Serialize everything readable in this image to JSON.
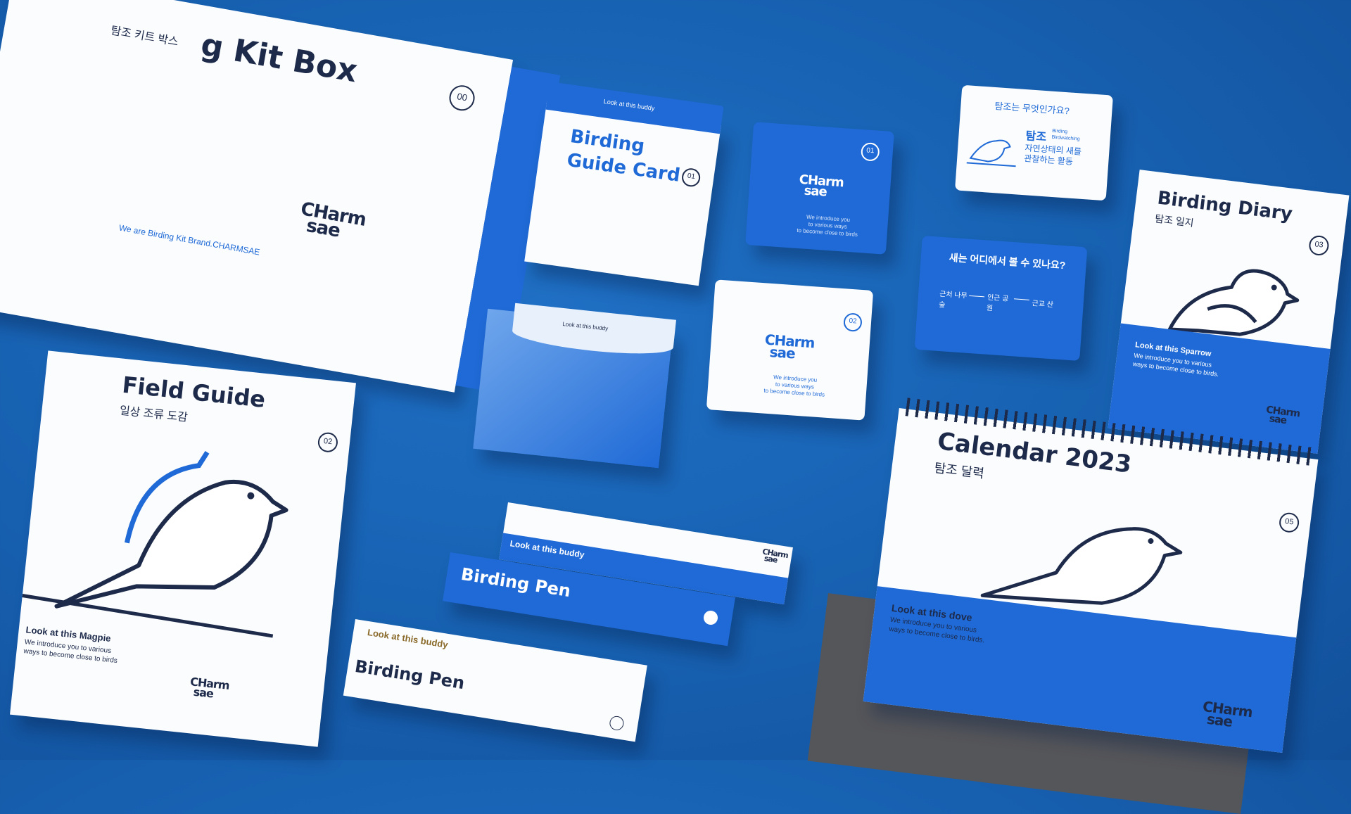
{
  "box": {
    "title": "g Kit Box",
    "subtitle": "탐조 키트 박스",
    "number": "00",
    "tagline": "We are Birding Kit Brand.CHARMSAE",
    "logo_line1": "CHarm",
    "logo_line2": "sae"
  },
  "guide_card": {
    "title_line1": "Birding",
    "title_line2": "Guide Card",
    "number": "01",
    "flap_text": "Look at this buddy"
  },
  "card_01": {
    "number": "01",
    "logo_line1": "CHarm",
    "logo_line2": "sae",
    "caption_line1": "We introduce you",
    "caption_line2": "to various ways",
    "caption_line3": "to become close to birds"
  },
  "info_card_1": {
    "heading": "탐조는 무엇인가요?",
    "term": "탐조",
    "term_en1": "Birding",
    "term_en2": "Birdwatching",
    "desc_line1": "자연상태의 새를",
    "desc_line2": "관찰하는 활동"
  },
  "info_card_2": {
    "heading": "새는 어디에서 볼 수 있나요?",
    "step1": "근처 나무 숲",
    "step2": "인근 공원",
    "step3": "근교 산"
  },
  "envelope": {
    "flap_text": "Look at this buddy"
  },
  "card_02": {
    "number": "02",
    "logo_line1": "CHarm",
    "logo_line2": "sae",
    "caption_line1": "We introduce you",
    "caption_line2": "to various ways",
    "caption_line3": "to become close to birds"
  },
  "diary": {
    "title": "Birding Diary",
    "subtitle": "탐조 일지",
    "number": "03",
    "bottom_line1": "Look at this Sparrow",
    "bottom_line2": "We introduce you to various",
    "bottom_line3": "ways to become close to birds.",
    "logo_line1": "CHarm",
    "logo_line2": "sae"
  },
  "field_guide": {
    "title": "Field Guide",
    "subtitle": "일상 조류 도감",
    "number": "02",
    "bottom_line1": "Look at this Magpie",
    "bottom_line2": "We introduce you to various",
    "bottom_line3": "ways to become close to birds",
    "logo_line1": "CHarm",
    "logo_line2": "sae"
  },
  "pen_box_1": {
    "label": "Look at this buddy",
    "logo_line1": "CHarm",
    "logo_line2": "sae"
  },
  "pen_box_2": {
    "title": "Birding Pen"
  },
  "pen_box_3": {
    "label": "Look at this buddy",
    "title": "Birding Pen"
  },
  "calendar": {
    "title": "Calendar 2023",
    "subtitle": "탐조 달력",
    "number": "05",
    "bottom_line1": "Look at this dove",
    "bottom_line2": "We introduce you to various",
    "bottom_line3": "ways to become close to birds.",
    "logo_line1": "CHarm",
    "logo_line2": "sae"
  },
  "colors": {
    "background": "#1866b8",
    "brand_blue": "#1f6ad6",
    "navy": "#1d2a4a",
    "paper": "#fbfcfe"
  }
}
